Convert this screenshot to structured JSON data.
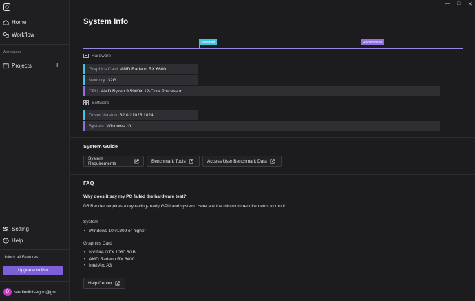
{
  "sidebar": {
    "nav": [
      {
        "label": "Home",
        "icon": "home-icon"
      },
      {
        "label": "Workflow",
        "icon": "workflow-icon"
      }
    ],
    "workspace_label": "Workspace",
    "projects_label": "Projects",
    "bottom_nav": [
      {
        "label": "Setting",
        "icon": "sliders-icon"
      },
      {
        "label": "Help",
        "icon": "help-icon"
      }
    ],
    "unlock_text": "Unlock all Features",
    "upgrade_label": "Upgrade to Pro",
    "avatar_initial": "D",
    "user_email": "studiodidisegno@gm..."
  },
  "page": {
    "title": "System Info"
  },
  "levels": {
    "standard": "Standard",
    "recommend": "Recommend",
    "standard_color": "#3ec6e0",
    "recommend_color": "#8f71dd"
  },
  "hardware": {
    "heading": "Hardware",
    "rows": [
      {
        "label": "Graphics Card",
        "value": "AMD Radeon RX 6600"
      },
      {
        "label": "Memory",
        "value": "32G"
      },
      {
        "label": "CPU",
        "value": "AMD Ryzen 9 5900X 12-Core Processor"
      }
    ]
  },
  "software": {
    "heading": "Software",
    "rows": [
      {
        "label": "Driver Version",
        "value": "32.0.21025.1024"
      },
      {
        "label": "System",
        "value": "Windows 10"
      }
    ]
  },
  "guide": {
    "heading": "System Guide",
    "buttons": [
      "System Requirements",
      "Benchmark Tools",
      "Access User Benchmark Data"
    ]
  },
  "faq": {
    "heading": "FAQ",
    "question": "Why does it say my PC failed the hardware test?",
    "answer": "D5 Render requires a raytracing-ready GPU and system. Here are the minimum requirements to run it:",
    "system_label": "System",
    "system_items": [
      "Windows 10 v1809 or higher"
    ],
    "gpu_label": "Graphics Card",
    "gpu_items": [
      "NVIDIA GTX 1060 6GB",
      "AMD Radeon RX 6400",
      "Intel Arc A3"
    ],
    "help_center": "Help Center"
  }
}
